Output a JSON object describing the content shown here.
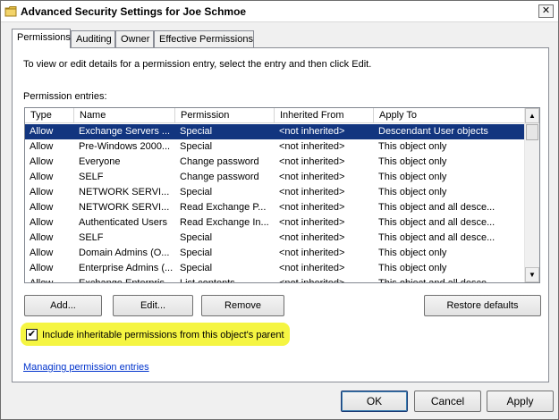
{
  "window": {
    "title": "Advanced Security Settings for Joe Schmoe",
    "close_glyph": "✕"
  },
  "tabs": [
    {
      "label": "Permissions",
      "active": true
    },
    {
      "label": "Auditing",
      "active": false
    },
    {
      "label": "Owner",
      "active": false
    },
    {
      "label": "Effective Permissions",
      "active": false
    }
  ],
  "permissions": {
    "intro": "To view or edit details for a permission entry, select the entry and then click Edit.",
    "entries_label": "Permission entries:",
    "columns": [
      "Type",
      "Name",
      "Permission",
      "Inherited From",
      "Apply To"
    ],
    "rows": [
      [
        "Allow",
        "Exchange Servers ...",
        "Special",
        "<not inherited>",
        "Descendant User objects"
      ],
      [
        "Allow",
        "Pre-Windows 2000...",
        "Special",
        "<not inherited>",
        "This object only"
      ],
      [
        "Allow",
        "Everyone",
        "Change password",
        "<not inherited>",
        "This object only"
      ],
      [
        "Allow",
        "SELF",
        "Change password",
        "<not inherited>",
        "This object only"
      ],
      [
        "Allow",
        "NETWORK SERVI...",
        "Special",
        "<not inherited>",
        "This object only"
      ],
      [
        "Allow",
        "NETWORK SERVI...",
        "Read Exchange P...",
        "<not inherited>",
        "This object and all desce..."
      ],
      [
        "Allow",
        "Authenticated Users",
        "Read Exchange In...",
        "<not inherited>",
        "This object and all desce..."
      ],
      [
        "Allow",
        "SELF",
        "Special",
        "<not inherited>",
        "This object and all desce..."
      ],
      [
        "Allow",
        "Domain Admins (O...",
        "Special",
        "<not inherited>",
        "This object only"
      ],
      [
        "Allow",
        "Enterprise Admins (...",
        "Special",
        "<not inherited>",
        "This object only"
      ],
      [
        "Allow",
        "Exchange Enterpris...",
        "List contents",
        "<not inherited>",
        "This object and all desce..."
      ]
    ],
    "selected_row": 0,
    "scroll_up_glyph": "▲",
    "scroll_down_glyph": "▼",
    "buttons": {
      "add": "Add...",
      "edit": "Edit...",
      "remove": "Remove",
      "restore": "Restore defaults"
    },
    "inherit_checkbox": {
      "label": "Include inheritable permissions from this object's parent",
      "checked": true,
      "check_glyph": "✔",
      "highlight_color": "#f5f542"
    },
    "help_link": "Managing permission entries"
  },
  "footer": {
    "ok": "OK",
    "cancel": "Cancel",
    "apply": "Apply"
  },
  "colors": {
    "selected_row": "#12357f",
    "link": "#0033cc"
  }
}
